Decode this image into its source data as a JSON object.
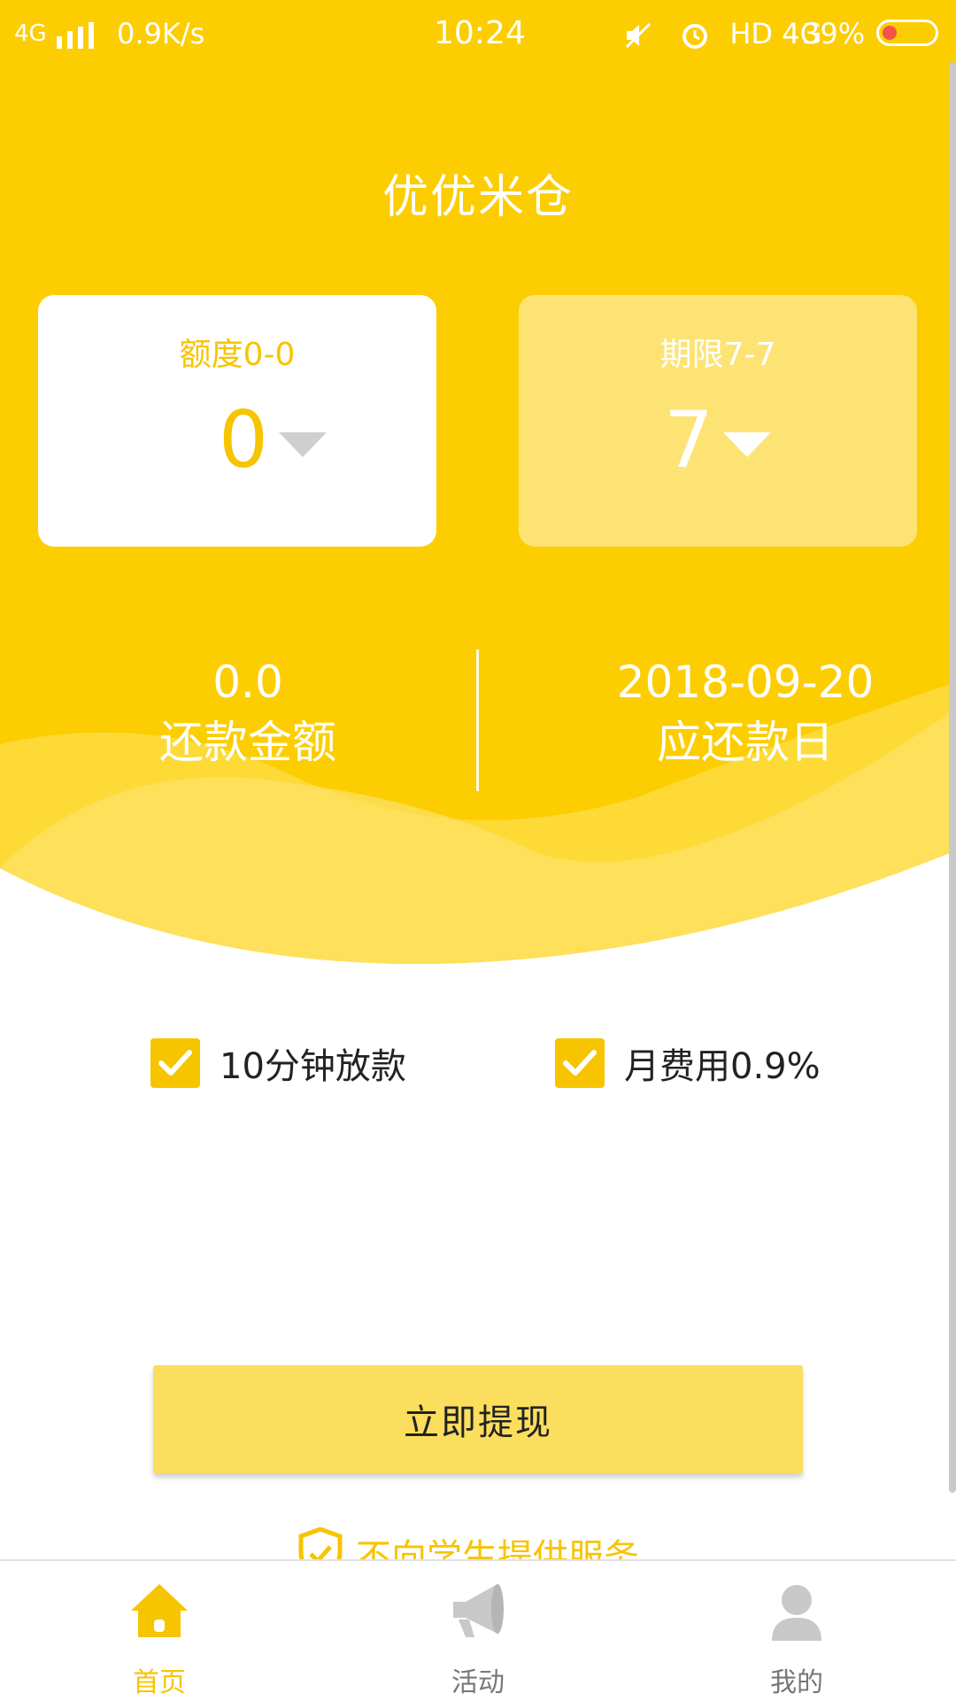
{
  "status_bar": {
    "network": "4G",
    "speed": "0.9K/s",
    "time": "10:24",
    "indicators": "HD 4G",
    "battery": "39%",
    "icons": [
      "signal-bars-icon",
      "mute-icon",
      "alarm-icon",
      "battery-icon"
    ]
  },
  "header": {
    "title": "优优米仓"
  },
  "cards": {
    "amount": {
      "label": "额度0-0",
      "value": "0"
    },
    "term": {
      "label": "期限7-7",
      "value": "7"
    }
  },
  "summary": {
    "repayment_amount": {
      "value": "0.0",
      "label": "还款金额"
    },
    "due_date": {
      "value": "2018-09-20",
      "label": "应还款日"
    }
  },
  "features": [
    {
      "label": "10分钟放款",
      "checked": true
    },
    {
      "label": "月费用0.9%",
      "checked": true
    }
  ],
  "action": {
    "withdraw_label": "立即提现"
  },
  "notice": {
    "text": "不向学生提供服务"
  },
  "tabbar": {
    "items": [
      {
        "label": "首页",
        "icon": "home-icon",
        "active": true
      },
      {
        "label": "活动",
        "icon": "megaphone-icon",
        "active": false
      },
      {
        "label": "我的",
        "icon": "user-icon",
        "active": false
      }
    ]
  },
  "colors": {
    "brand_yellow": "#fccd00",
    "accent_yellow": "#f7c400",
    "button_yellow": "#fbde5d",
    "inactive_gray": "#c8c8c8"
  }
}
